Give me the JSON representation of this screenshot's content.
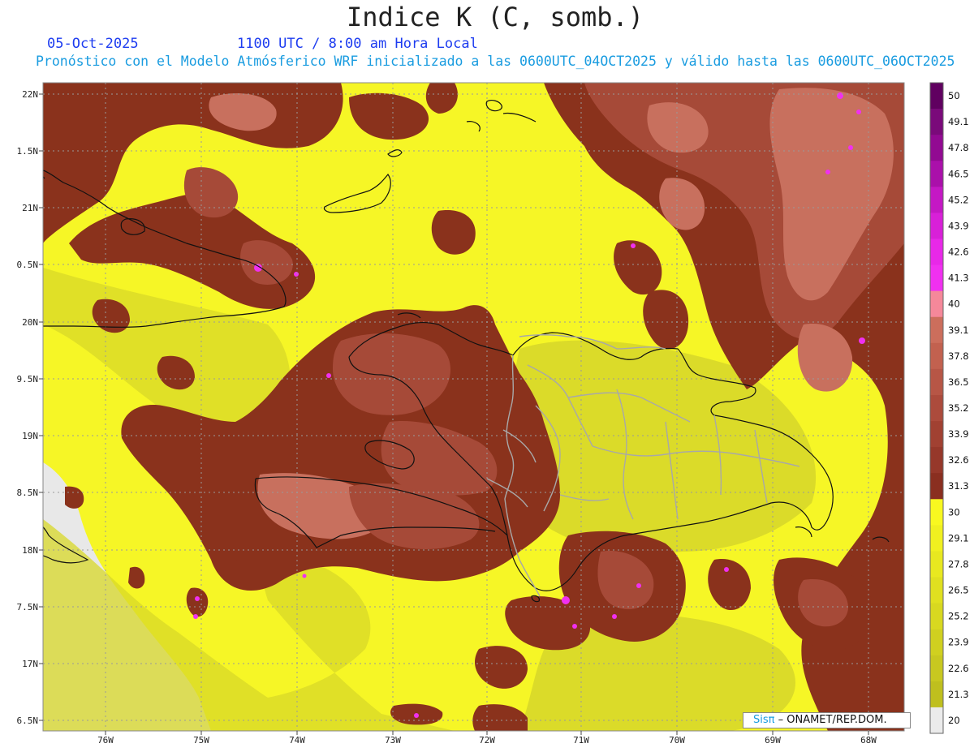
{
  "header": {
    "title": "Indice K (C, somb.)",
    "date": "05-Oct-2025",
    "time": "1100 UTC / 8:00 am Hora Local",
    "forecast_line": "Pronóstico con el Modelo Atmósferico WRF inicializado a las 0600UTC_04OCT2025 y válido hasta las  0600UTC_06OCT2025"
  },
  "map": {
    "lat_labels": [
      "22N",
      "1.5N",
      "21N",
      "0.5N",
      "20N",
      "9.5N",
      "19N",
      "8.5N",
      "18N",
      "7.5N",
      "17N",
      "6.5N"
    ],
    "lon_labels": [
      "76W",
      "75W",
      "74W",
      "73W",
      "72W",
      "71W",
      "70W",
      "69W",
      "68W"
    ],
    "colors": {
      "below_20": "#e8e8e8",
      "yellow": "#f6f626",
      "olive": "#cfcf2a",
      "brown": "#8a321c",
      "rust": "#a64a38",
      "salmon": "#c8705e",
      "magenta": "#f030f0",
      "border": "#111111",
      "admin": "#aaaaaa"
    }
  },
  "colorbar": {
    "labels": [
      "50",
      "49.1",
      "47.8",
      "46.5",
      "45.2",
      "43.9",
      "42.6",
      "41.3",
      "40",
      "39.1",
      "37.8",
      "36.5",
      "35.2",
      "33.9",
      "32.6",
      "31.3",
      "30",
      "29.1",
      "27.8",
      "26.5",
      "25.2",
      "23.9",
      "22.6",
      "21.3",
      "20"
    ],
    "colors": [
      "#600060",
      "#7a0a7a",
      "#920a92",
      "#aa10aa",
      "#c418c4",
      "#d820d8",
      "#e828e8",
      "#f030f0",
      "#f5889a",
      "#cc6e5c",
      "#c2614f",
      "#b75646",
      "#ac4b3c",
      "#a14132",
      "#96382a",
      "#8a2f20",
      "#f8f820",
      "#f0f020",
      "#e8e820",
      "#e0e020",
      "#d8d820",
      "#d0d020",
      "#c8c820",
      "#bfbf1e",
      "#ebebeb"
    ]
  },
  "credit": {
    "brand": "Sisπ",
    "text": " – ONAMET/REP.DOM."
  }
}
